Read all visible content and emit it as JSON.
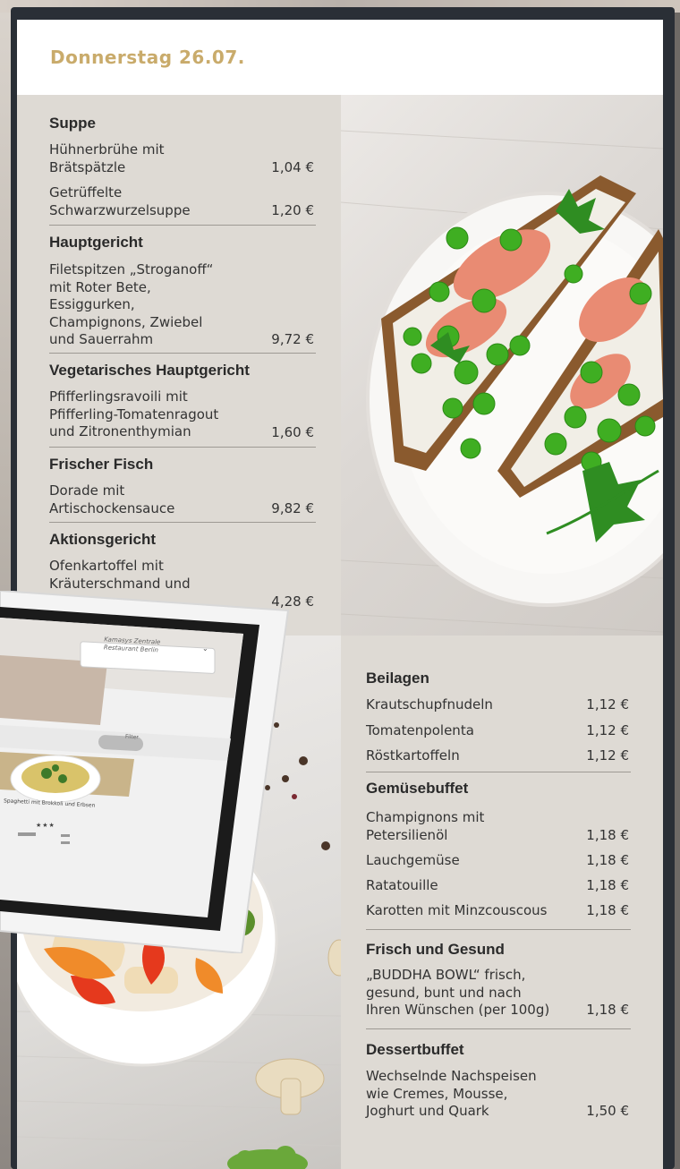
{
  "header": {
    "date": "Donnerstag 26.07."
  },
  "menu_left": [
    {
      "title": "Suppe",
      "items": [
        {
          "name_lines": [
            "Hühnerbrühe mit",
            "Brätspätzle"
          ],
          "price": "1,04 €"
        },
        {
          "name_lines": [
            "Getrüffelte",
            "Schwarzwurzelsuppe"
          ],
          "price": "1,20 €"
        }
      ]
    },
    {
      "title": "Hauptgericht",
      "items": [
        {
          "name_lines": [
            "Filetspitzen „Stroganoff“",
            "mit Roter Bete,",
            "Essiggurken,",
            "Champignons, Zwiebel",
            "und Sauerrahm"
          ],
          "price": "9,72 €"
        }
      ]
    },
    {
      "title": "Vegetarisches Hauptgericht",
      "items": [
        {
          "name_lines": [
            "Pfifferlingsravoili mit",
            "Pfifferling-Tomatenragout",
            "und Zitronenthymian"
          ],
          "price": "1,60 €"
        }
      ]
    },
    {
      "title": "Frischer Fisch",
      "items": [
        {
          "name_lines": [
            "Dorade mit",
            "Artischockensauce"
          ],
          "price": "9,82 €"
        }
      ]
    },
    {
      "title": "Aktionsgericht",
      "items": [
        {
          "name_lines": [
            "Ofenkartoffel mit",
            "Kräuterschmand und"
          ],
          "price": "4,28 €"
        }
      ]
    }
  ],
  "menu_right": [
    {
      "title": "Beilagen",
      "items": [
        {
          "name_lines": [
            "Krautschupfnudeln"
          ],
          "price": "1,12 €"
        },
        {
          "name_lines": [
            "Tomatenpolenta"
          ],
          "price": "1,12 €"
        },
        {
          "name_lines": [
            "Röstkartoffeln"
          ],
          "price": "1,12 €"
        }
      ]
    },
    {
      "title": "Gemüsebuffet",
      "items": [
        {
          "name_lines": [
            "Champignons mit",
            "Petersilienöl"
          ],
          "price": "1,18 €"
        },
        {
          "name_lines": [
            "Lauchgemüse"
          ],
          "price": "1,18 €"
        },
        {
          "name_lines": [
            "Ratatouille"
          ],
          "price": "1,18 €"
        },
        {
          "name_lines": [
            "Karotten mit Minzcouscous"
          ],
          "price": "1,18 €"
        }
      ]
    },
    {
      "title": "Frisch und Gesund",
      "items": [
        {
          "name_lines": [
            "„BUDDHA BOWL“ frisch,",
            "gesund, bunt und nach",
            "Ihren Wünschen (per 100g)"
          ],
          "price": "1,18 €"
        }
      ]
    },
    {
      "title": "Dessertbuffet",
      "items": [
        {
          "name_lines": [
            "Wechselnde Nachspeisen",
            "wie Cremes, Mousse,",
            "Joghurt und Quark"
          ],
          "price": "1,50 €"
        }
      ]
    }
  ],
  "tablet": {
    "location_lines": [
      "Kamasys Zentrale",
      "Restaurant Berlin"
    ],
    "filter_label": "Filter",
    "dish_caption": "Spaghetti mit Brokkoli und Erbsen"
  },
  "colors": {
    "accent_gold": "#c9ab6b",
    "panel_bg": "#dedad4",
    "bezel": "#2a2f36"
  }
}
